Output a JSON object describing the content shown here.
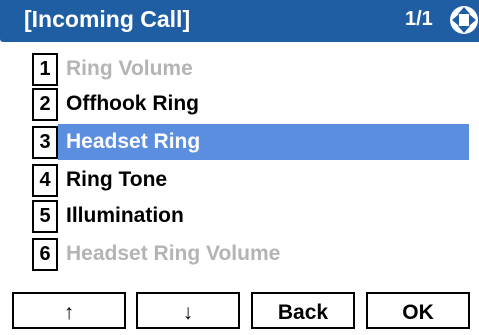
{
  "header": {
    "title": "[Incoming Call]",
    "page": "1/1",
    "nav_icon": "four-way-arrow-icon",
    "color": "#1f5ea3"
  },
  "menu": {
    "selected_index": 3,
    "selected_color": "#5c8ee0",
    "items": [
      {
        "number": "1",
        "label": "Ring Volume",
        "enabled": false
      },
      {
        "number": "2",
        "label": "Offhook Ring",
        "enabled": true
      },
      {
        "number": "3",
        "label": "Headset Ring",
        "enabled": true
      },
      {
        "number": "4",
        "label": "Ring Tone",
        "enabled": true
      },
      {
        "number": "5",
        "label": "Illumination",
        "enabled": true
      },
      {
        "number": "6",
        "label": "Headset Ring Volume",
        "enabled": false
      }
    ]
  },
  "softkeys": {
    "up": "↑",
    "down": "↓",
    "back": "Back",
    "ok": "OK"
  }
}
